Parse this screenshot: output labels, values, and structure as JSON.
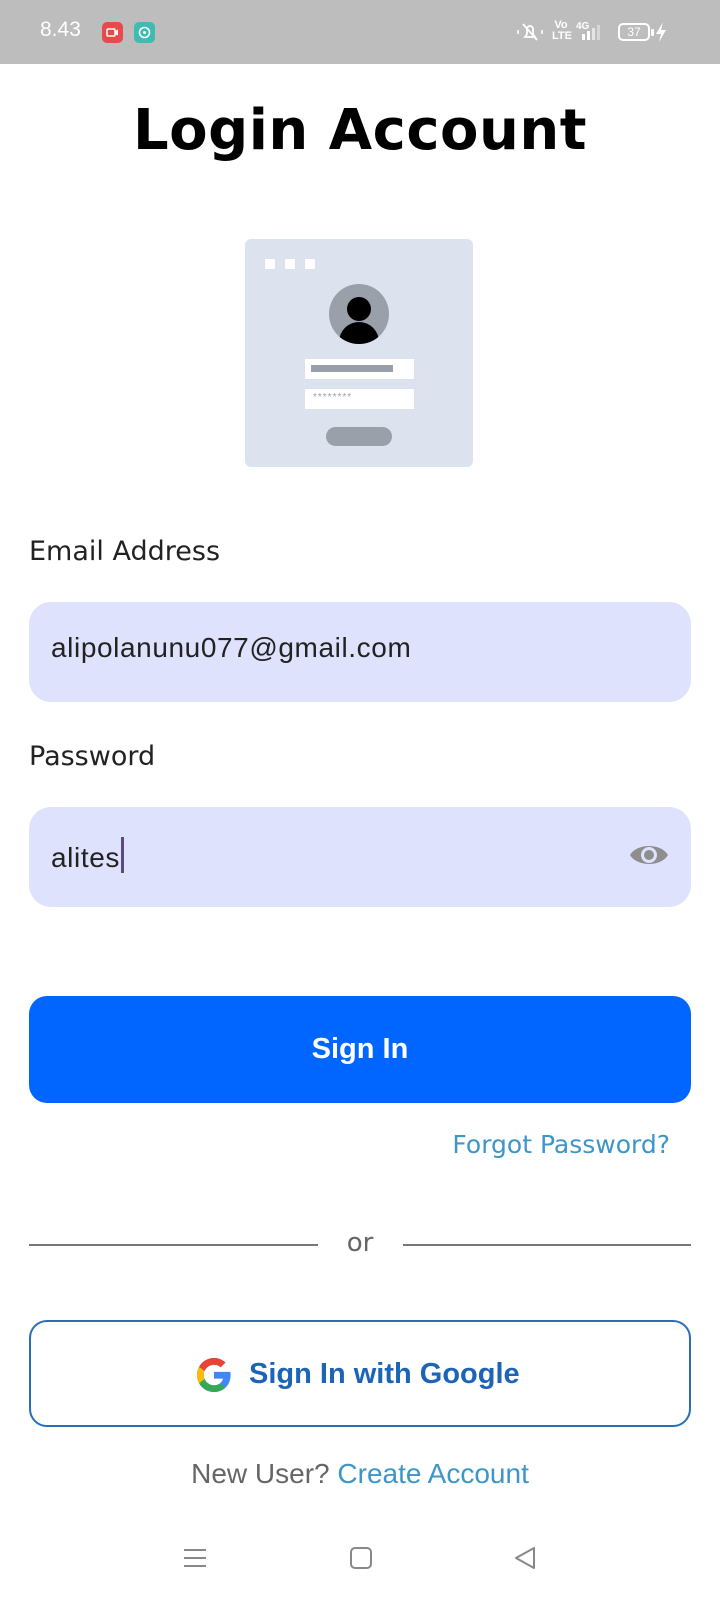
{
  "status_bar": {
    "time": "8.43",
    "volte_label": "Vo LTE",
    "network_label": "4G",
    "battery_level": "37",
    "icons": [
      "screen-record-icon",
      "chat-icon",
      "mute-icon",
      "signal-icon",
      "charging-icon"
    ]
  },
  "page": {
    "title": "Login Account"
  },
  "form": {
    "email_label": "Email Address",
    "email_value": "alipolanunu077@gmail.com",
    "password_label": "Password",
    "password_value": "alites",
    "illustration_password_mask": "********"
  },
  "actions": {
    "sign_in_label": "Sign In",
    "forgot_password_label": "Forgot Password?",
    "divider_label": "or",
    "google_sign_in_label": "Sign In with Google",
    "new_user_text": "New User?",
    "create_account_label": "Create Account"
  },
  "colors": {
    "primary": "#0066ff",
    "field_background": "#dfe2fd",
    "link": "#3d95c8",
    "google_border": "#2a6fb6"
  }
}
